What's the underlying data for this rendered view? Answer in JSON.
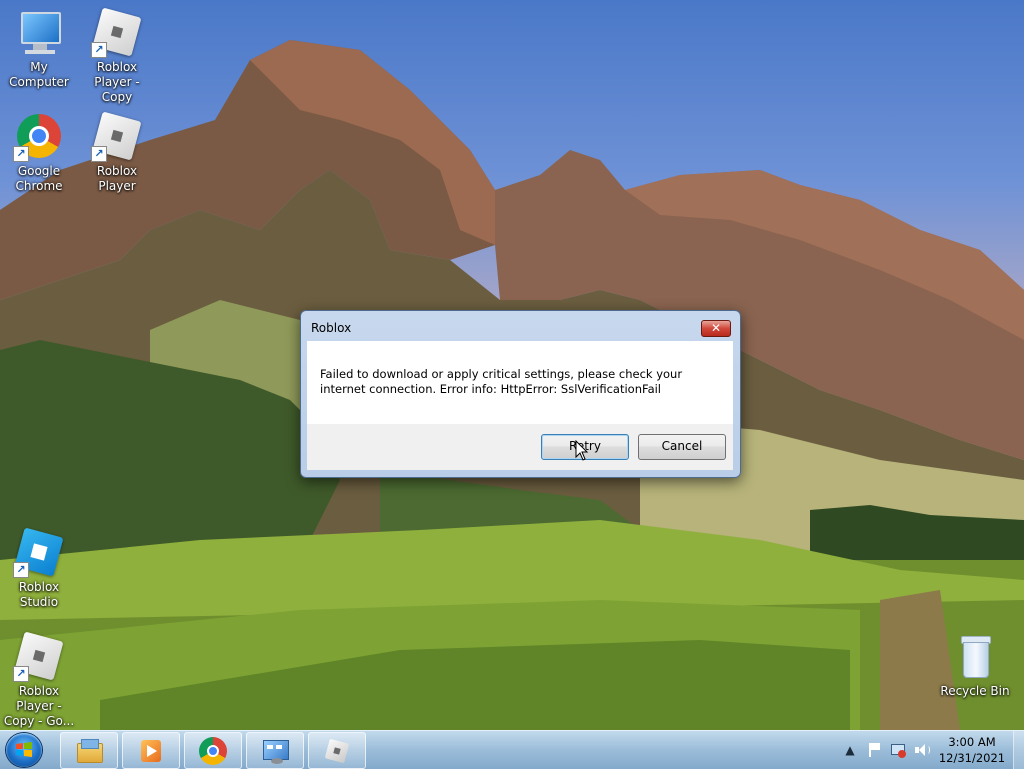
{
  "desktop": {
    "icons": [
      {
        "label": "My Computer",
        "icon": "my-computer-icon"
      },
      {
        "label": "Roblox Player - Copy",
        "icon": "roblox-player-icon"
      },
      {
        "label": "Google Chrome",
        "icon": "chrome-icon"
      },
      {
        "label": "Roblox Player",
        "icon": "roblox-player-icon"
      },
      {
        "label": "Roblox Studio",
        "icon": "roblox-studio-icon"
      },
      {
        "label": "Roblox Player - Copy - Go...",
        "icon": "roblox-player-icon"
      },
      {
        "label": "Recycle Bin",
        "icon": "recycle-bin-icon"
      }
    ]
  },
  "dialog": {
    "title": "Roblox",
    "close": "✕",
    "message": "Failed to download or apply critical settings, please check your internet connection. Error info: HttpError: SslVerificationFail",
    "buttons": {
      "retry": "Retry",
      "cancel": "Cancel"
    }
  },
  "taskbar": {
    "items": [
      "windows-explorer-icon",
      "media-player-icon",
      "chrome-icon",
      "control-panel-icon",
      "roblox-icon"
    ],
    "tray": {
      "icons": [
        "show-hidden-icons-icon",
        "action-center-flag-icon",
        "network-icon",
        "volume-icon"
      ],
      "time": "3:00 AM",
      "date": "12/31/2021"
    }
  }
}
